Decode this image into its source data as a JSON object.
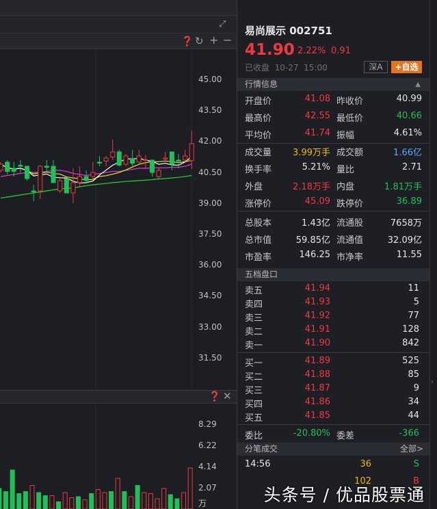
{
  "chart_panel": {
    "price_axis": [
      "45.00",
      "43.50",
      "42.00",
      "40.50",
      "39.00",
      "37.50",
      "36.00",
      "34.50",
      "33.00",
      "31.50"
    ],
    "volume_axis": [
      "8.29",
      "6.22",
      "4.14",
      "2.07"
    ],
    "volume_unit": "万"
  },
  "quote": {
    "name": "易尚展示",
    "code": "002751",
    "price": "41.90",
    "change_pct": "2.22%",
    "change": "0.91",
    "status": "已收盘",
    "date": "10-27",
    "time": "15:00",
    "market": "深A",
    "add_watch": "自选"
  },
  "sections": {
    "info": "行情信息",
    "book": "五档盘口",
    "ticks": "分笔成交",
    "all": "全部>"
  },
  "stats": [
    [
      {
        "l": "开盘价",
        "v": "41.08",
        "c": "red"
      },
      {
        "l": "昨收价",
        "v": "40.99",
        "c": "white"
      }
    ],
    [
      {
        "l": "最高价",
        "v": "42.55",
        "c": "red"
      },
      {
        "l": "最低价",
        "v": "40.66",
        "c": "green"
      }
    ],
    [
      {
        "l": "平均价",
        "v": "41.74",
        "c": "red"
      },
      {
        "l": "振幅",
        "v": "4.61%",
        "c": "white"
      }
    ],
    [
      {
        "l": "成交量",
        "v": "3.99万手",
        "c": "yel"
      },
      {
        "l": "成交额",
        "v": "1.66亿",
        "c": "blue"
      }
    ],
    [
      {
        "l": "换手率",
        "v": "5.21%",
        "c": "white"
      },
      {
        "l": "量比",
        "v": "2.71",
        "c": "white"
      }
    ],
    [
      {
        "l": "外盘",
        "v": "2.18万手",
        "c": "red"
      },
      {
        "l": "内盘",
        "v": "1.81万手",
        "c": "green"
      }
    ],
    [
      {
        "l": "涨停价",
        "v": "45.09",
        "c": "red"
      },
      {
        "l": "跌停价",
        "v": "36.89",
        "c": "green"
      }
    ],
    [
      {
        "l": "总股本",
        "v": "1.43亿",
        "c": "white"
      },
      {
        "l": "流通股",
        "v": "7658万",
        "c": "white"
      }
    ],
    [
      {
        "l": "总市值",
        "v": "59.85亿",
        "c": "white"
      },
      {
        "l": "流通值",
        "v": "32.09亿",
        "c": "white"
      }
    ],
    [
      {
        "l": "市盈率",
        "v": "146.25",
        "c": "white"
      },
      {
        "l": "市净率",
        "v": "11.55",
        "c": "white"
      }
    ]
  ],
  "asks": [
    {
      "l": "卖五",
      "p": "41.94",
      "q": "11"
    },
    {
      "l": "卖四",
      "p": "41.93",
      "q": "5"
    },
    {
      "l": "卖三",
      "p": "41.92",
      "q": "77"
    },
    {
      "l": "卖二",
      "p": "41.91",
      "q": "128"
    },
    {
      "l": "卖一",
      "p": "41.90",
      "q": "842"
    }
  ],
  "bids": [
    {
      "l": "买一",
      "p": "41.89",
      "q": "525"
    },
    {
      "l": "买二",
      "p": "41.88",
      "q": "85"
    },
    {
      "l": "买三",
      "p": "41.87",
      "q": "9"
    },
    {
      "l": "买四",
      "p": "41.86",
      "q": "34"
    },
    {
      "l": "买五",
      "p": "41.85",
      "q": "44"
    }
  ],
  "ratio": {
    "l": "委比",
    "v": "-20.80%",
    "l2": "委差",
    "v2": "-366"
  },
  "ticks": [
    {
      "t": "14:56",
      "q": "36",
      "s": "S"
    },
    {
      "t": "",
      "q": "102",
      "s": "B"
    }
  ],
  "watermark": "头条号 / 优品股票通",
  "chart_data": {
    "type": "candlestick",
    "ylim": [
      30.5,
      46
    ],
    "candles": [
      [
        40.6,
        40.9,
        41.0,
        40.5
      ],
      [
        41.0,
        40.55,
        41.1,
        40.4
      ],
      [
        40.7,
        40.55,
        41.0,
        40.3
      ],
      [
        40.85,
        40.8,
        41.1,
        40.5
      ],
      [
        40.8,
        40.2,
        40.8,
        40.1
      ],
      [
        39.6,
        39.55,
        39.9,
        39.1
      ],
      [
        39.6,
        40.8,
        40.85,
        39.2
      ],
      [
        40.8,
        40.75,
        41.1,
        40.5
      ],
      [
        40.8,
        40.0,
        41.1,
        40.0
      ],
      [
        39.6,
        40.1,
        40.2,
        39.5
      ],
      [
        40.2,
        39.5,
        40.2,
        39.5
      ],
      [
        39.5,
        40.0,
        40.7,
        39.0
      ],
      [
        40.0,
        40.3,
        40.8,
        39.8
      ],
      [
        40.3,
        40.1,
        40.6,
        40.0
      ],
      [
        40.3,
        40.5,
        41.0,
        40.2
      ],
      [
        41.0,
        40.95,
        41.3,
        40.8
      ],
      [
        41.05,
        41.2,
        41.3,
        40.8
      ],
      [
        41.25,
        41.5,
        42.1,
        41.1
      ],
      [
        41.5,
        40.85,
        41.6,
        40.8
      ],
      [
        40.9,
        41.3,
        41.4,
        40.8
      ],
      [
        41.15,
        40.95,
        41.6,
        40.8
      ],
      [
        41.0,
        41.3,
        41.6,
        40.9
      ],
      [
        41.1,
        41.12,
        41.35,
        40.7
      ],
      [
        41.1,
        40.5,
        41.1,
        40.3
      ],
      [
        40.3,
        40.6,
        40.7,
        40.2
      ],
      [
        41.15,
        41.2,
        41.5,
        41.0
      ],
      [
        41.5,
        40.9,
        41.5,
        40.6
      ],
      [
        41.1,
        41.05,
        41.4,
        40.7
      ],
      [
        41.1,
        41.3,
        41.6,
        41.0
      ],
      [
        41.08,
        41.9,
        42.55,
        40.66
      ]
    ],
    "ma60": [
      39.25,
      39.3,
      39.35,
      39.4,
      39.45,
      39.5,
      39.55,
      39.6,
      39.65,
      39.7,
      39.72,
      39.75,
      39.8,
      39.85,
      39.9,
      39.93,
      39.96,
      40.0,
      40.03,
      40.06,
      40.08,
      40.1,
      40.12,
      40.15,
      40.18,
      40.2,
      40.23,
      40.26,
      40.3,
      40.35
    ],
    "ma20": [
      40.3,
      40.35,
      40.4,
      40.45,
      40.5,
      40.5,
      40.5,
      40.55,
      40.6,
      40.6,
      40.55,
      40.45,
      40.4,
      40.35,
      40.4,
      40.45,
      40.5,
      40.55,
      40.55,
      40.6,
      40.65,
      40.7,
      40.7,
      40.72,
      40.72,
      40.72,
      40.75,
      40.75,
      40.8,
      40.9
    ],
    "volume": [
      2.3,
      2.3,
      2.2,
      2.0,
      1.7,
      3.8,
      1.5,
      1.7,
      2.3,
      1.6,
      1.3,
      1.3,
      0.7,
      1.6,
      1.1,
      1.2,
      0.9,
      1.5,
      1.9,
      1.6,
      1.7,
      3.0,
      1.7,
      1.2,
      2.3,
      1.6,
      1.5,
      1.0,
      2.0,
      1.4,
      1.0,
      1.6,
      4.0
    ],
    "vol_up": [
      1,
      0,
      1,
      0,
      0,
      0,
      0,
      0,
      1,
      0,
      0,
      1,
      0,
      1,
      1,
      0,
      1,
      0,
      1,
      1,
      0,
      1,
      0,
      1,
      0,
      1,
      1,
      1,
      1,
      0,
      0,
      1,
      1
    ]
  }
}
